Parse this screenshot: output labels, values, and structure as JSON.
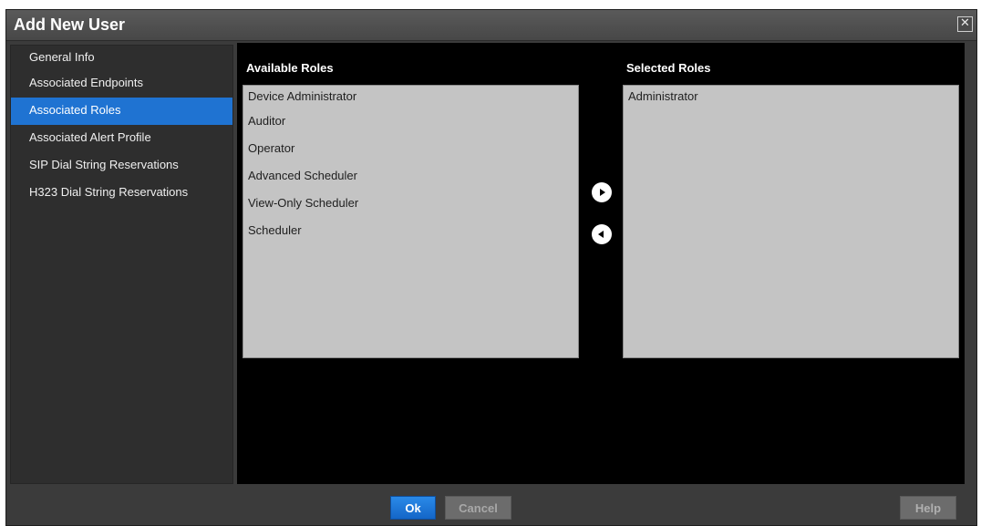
{
  "dialog": {
    "title": "Add New User",
    "close_icon": "close-icon"
  },
  "sidebar": {
    "items": [
      {
        "label": "General Info",
        "active": false
      },
      {
        "label": "Associated Endpoints",
        "active": false
      },
      {
        "label": "Associated Roles",
        "active": true
      },
      {
        "label": "Associated Alert Profile",
        "active": false
      },
      {
        "label": "SIP Dial String Reservations",
        "active": false
      },
      {
        "label": "H323 Dial String Reservations",
        "active": false
      }
    ]
  },
  "available_roles": {
    "header": "Available Roles",
    "items": [
      "Device Administrator",
      "Auditor",
      "Operator",
      "Advanced Scheduler",
      "View-Only Scheduler",
      "Scheduler"
    ]
  },
  "selected_roles": {
    "header": "Selected Roles",
    "items": [
      "Administrator"
    ]
  },
  "move_buttons": {
    "add_icon": "arrow-right-icon",
    "remove_icon": "arrow-left-icon"
  },
  "footer": {
    "ok_label": "Ok",
    "cancel_label": "Cancel",
    "help_label": "Help"
  },
  "colors": {
    "accent": "#1f73d2",
    "dialog_background": "#3b3b3b",
    "panel_background": "#000000",
    "list_background": "#c4c4c4"
  }
}
